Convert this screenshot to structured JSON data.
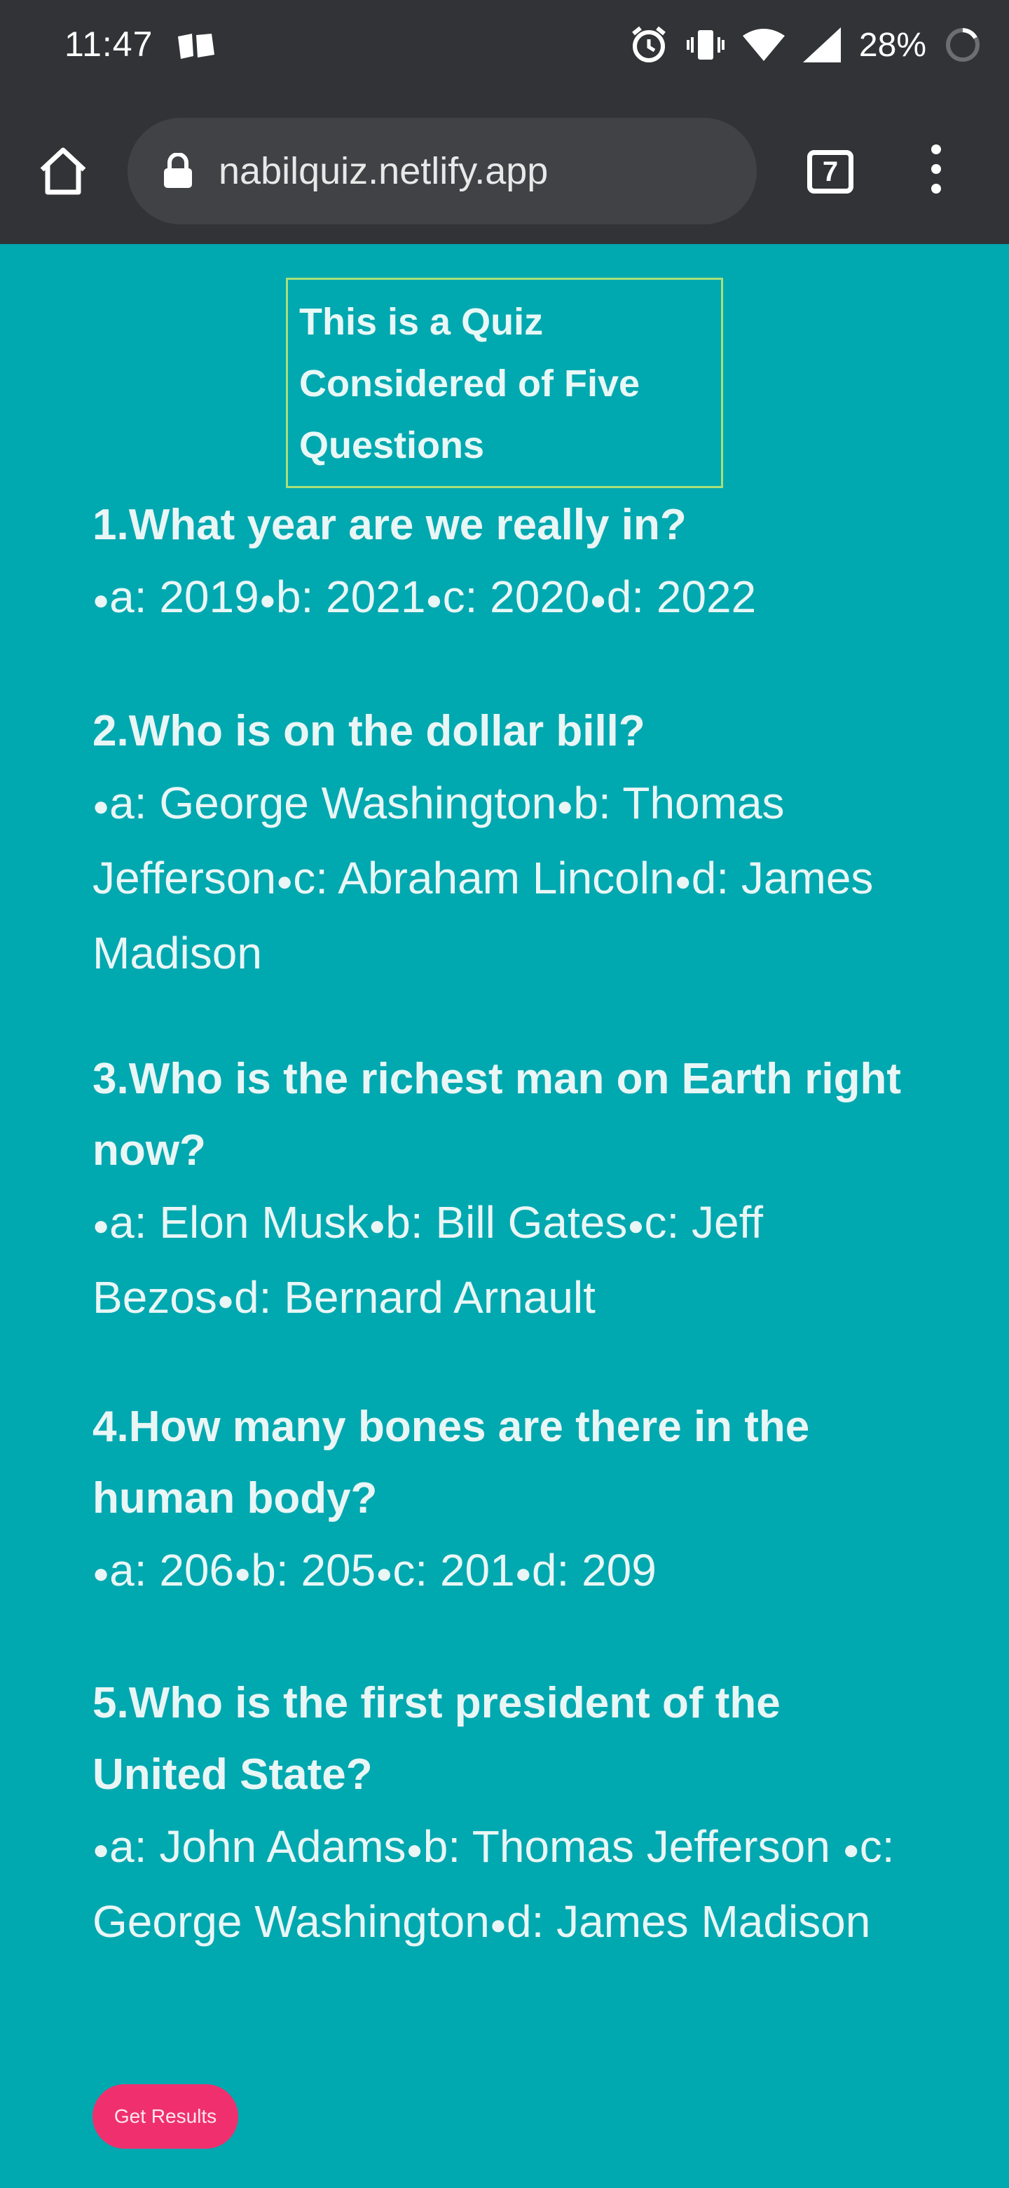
{
  "status_bar": {
    "time": "11:47",
    "battery": "28%",
    "icons": [
      "notification-icon",
      "alarm-icon",
      "vibrate-icon",
      "wifi-icon",
      "signal-icon",
      "battery-icon"
    ]
  },
  "browser": {
    "url": "nabilquiz.netlify.app",
    "tab_count": "7"
  },
  "page": {
    "heading": "This is a Quiz Considered of Five Questions",
    "questions": [
      {
        "title": "1.What year are we really in?",
        "options": "•a: 2019•b: 2021•c: 2020•d: 2022"
      },
      {
        "title": "2.Who is on the dollar bill?",
        "options": "•a: George Washington•b: Thomas Jefferson•c: Abraham Lincoln•d: James Madison"
      },
      {
        "title": "3.Who is the richest man on Earth right now?",
        "options": "•a: Elon Musk•b: Bill Gates•c: Jeff Bezos•d: Bernard Arnault"
      },
      {
        "title": "4.How many bones are there in the human body?",
        "options": "•a: 206•b: 205•c: 201•d: 209"
      },
      {
        "title": "5.Who is the first president of the United State?",
        "options": "•a: John Adams•b: Thomas Jefferson •c: George Washington•d: James Madison"
      }
    ],
    "get_results_label": "Get Results"
  },
  "colors": {
    "background": "#00a8b0",
    "chrome": "#323336",
    "button": "#f0306e",
    "title_border": "#a8e07a"
  }
}
